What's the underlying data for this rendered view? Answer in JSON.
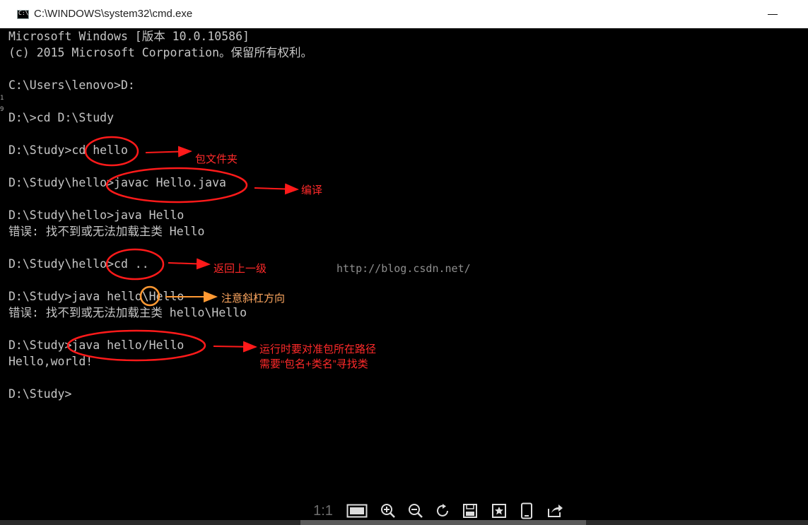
{
  "window": {
    "title": "C:\\WINDOWS\\system32\\cmd.exe"
  },
  "console": {
    "lines": [
      "Microsoft Windows [版本 10.0.10586]",
      "(c) 2015 Microsoft Corporation。保留所有权利。",
      "",
      "C:\\Users\\lenovo>D:",
      "",
      "D:\\>cd D:\\Study",
      "",
      "D:\\Study>cd hello",
      "",
      "D:\\Study\\hello>javac Hello.java",
      "",
      "D:\\Study\\hello>java Hello",
      "错误: 找不到或无法加载主类 Hello",
      "",
      "D:\\Study\\hello>cd ..",
      "",
      "D:\\Study>java hello\\Hello",
      "错误: 找不到或无法加载主类 hello\\Hello",
      "",
      "D:\\Study>java hello/Hello",
      "Hello,world!",
      "",
      "D:\\Study>"
    ],
    "gutter_marks": [
      "1",
      "9"
    ]
  },
  "annotations": {
    "package_folder": "包文件夹",
    "compile": "编译",
    "go_up": "返回上一级",
    "slash_direction": "注意斜杠方向",
    "run_note_line1": "运行时要对准包所在路径",
    "run_note_line2": "需要“包名+类名”寻找类",
    "red_color": "#ff1a1a",
    "orange_color": "#ff9933"
  },
  "watermark": "http://blog.csdn.net/",
  "viewer_toolbar": {
    "ratio_label": "1:1",
    "icons": [
      "fit-screen-icon",
      "zoom-in-icon",
      "zoom-out-icon",
      "rotate-icon",
      "save-icon",
      "favorite-icon",
      "mobile-icon",
      "share-icon"
    ]
  }
}
